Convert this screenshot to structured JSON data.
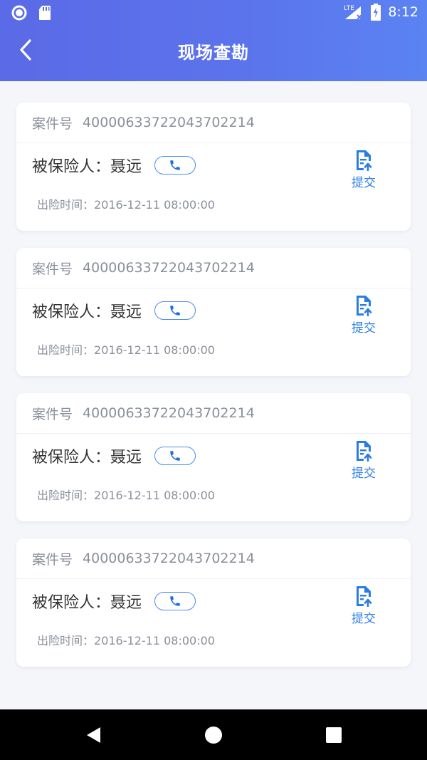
{
  "status_bar": {
    "time": "8:12",
    "network": "LTE",
    "icons": [
      "record-icon",
      "sd-card-icon",
      "signal-icon",
      "battery-charging-icon"
    ]
  },
  "header": {
    "title": "现场查勘",
    "back_icon": "chevron-left-icon"
  },
  "cards": [
    {
      "case_label": "案件号",
      "case_number": "40000633722043702214",
      "insured_label": "被保险人：",
      "insured_name": "聂远",
      "accident_label": "出险时间：",
      "accident_time": "2016-12-11 08:00:00",
      "submit_label": "提交"
    },
    {
      "case_label": "案件号",
      "case_number": "40000633722043702214",
      "insured_label": "被保险人：",
      "insured_name": "聂远",
      "accident_label": "出险时间：",
      "accident_time": "2016-12-11 08:00:00",
      "submit_label": "提交"
    },
    {
      "case_label": "案件号",
      "case_number": "40000633722043702214",
      "insured_label": "被保险人：",
      "insured_name": "聂远",
      "accident_label": "出险时间：",
      "accident_time": "2016-12-11 08:00:00",
      "submit_label": "提交"
    },
    {
      "case_label": "案件号",
      "case_number": "40000633722043702214",
      "insured_label": "被保险人：",
      "insured_name": "聂远",
      "accident_label": "出险时间：",
      "accident_time": "2016-12-11 08:00:00",
      "submit_label": "提交"
    }
  ],
  "colors": {
    "header_start": "#5b6ae6",
    "header_end": "#5b83f2",
    "accent": "#2a7de1",
    "muted_text": "#8a8f9c"
  },
  "nav_bar": {
    "icons": [
      "back-triangle-icon",
      "home-circle-icon",
      "recents-square-icon"
    ]
  }
}
